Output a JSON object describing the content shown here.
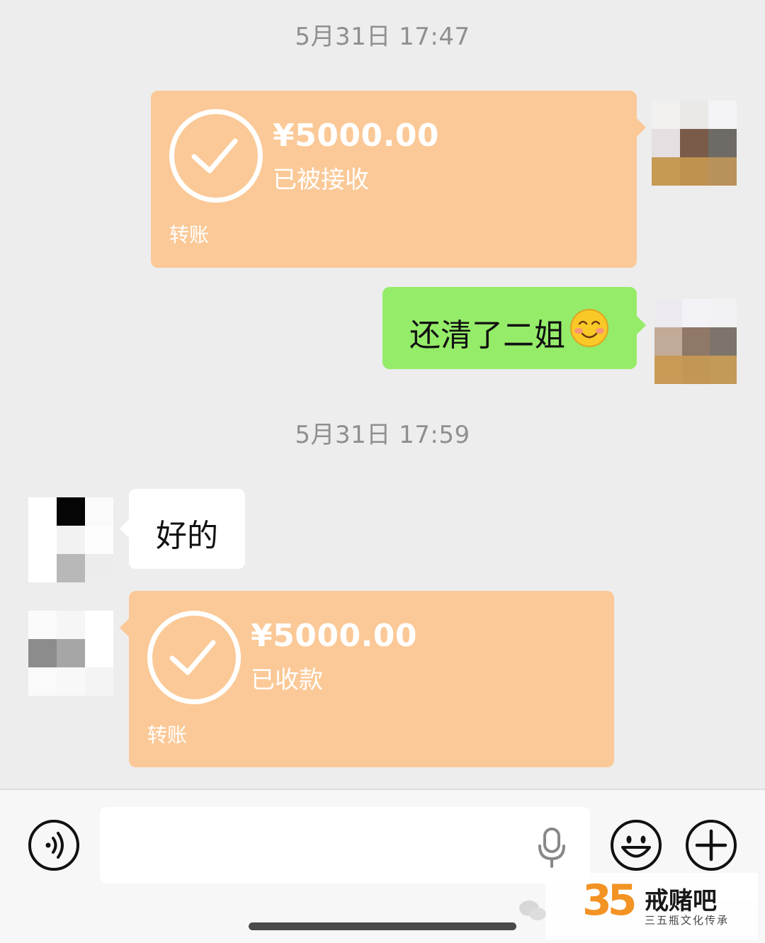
{
  "messages": {
    "time_1": "5月31日 17:47",
    "transfer_1": {
      "amount": "¥5000.00",
      "status": "已被接收",
      "kind": "转账"
    },
    "text_1": {
      "text": "还清了二姐",
      "emoji": "blush-smile-emoji"
    },
    "time_2": "5月31日 17:59",
    "text_2": {
      "text": "好的"
    },
    "transfer_2": {
      "amount": "¥5000.00",
      "status": "已收款",
      "kind": "转账"
    }
  },
  "input_bar": {
    "value": "",
    "icons": [
      "voice-mode-icon",
      "microphone-icon",
      "emoji-icon",
      "plus-icon"
    ]
  },
  "watermark": {
    "number": "35",
    "title": "戒赌吧",
    "subtitle": "三五瓶文化传承"
  },
  "colors": {
    "background": "#ededed",
    "transfer_bubble": "#fbc997",
    "sent_bubble": "#95ec69",
    "received_bubble": "#ffffff",
    "timestamp_text": "#8f8f8f"
  }
}
